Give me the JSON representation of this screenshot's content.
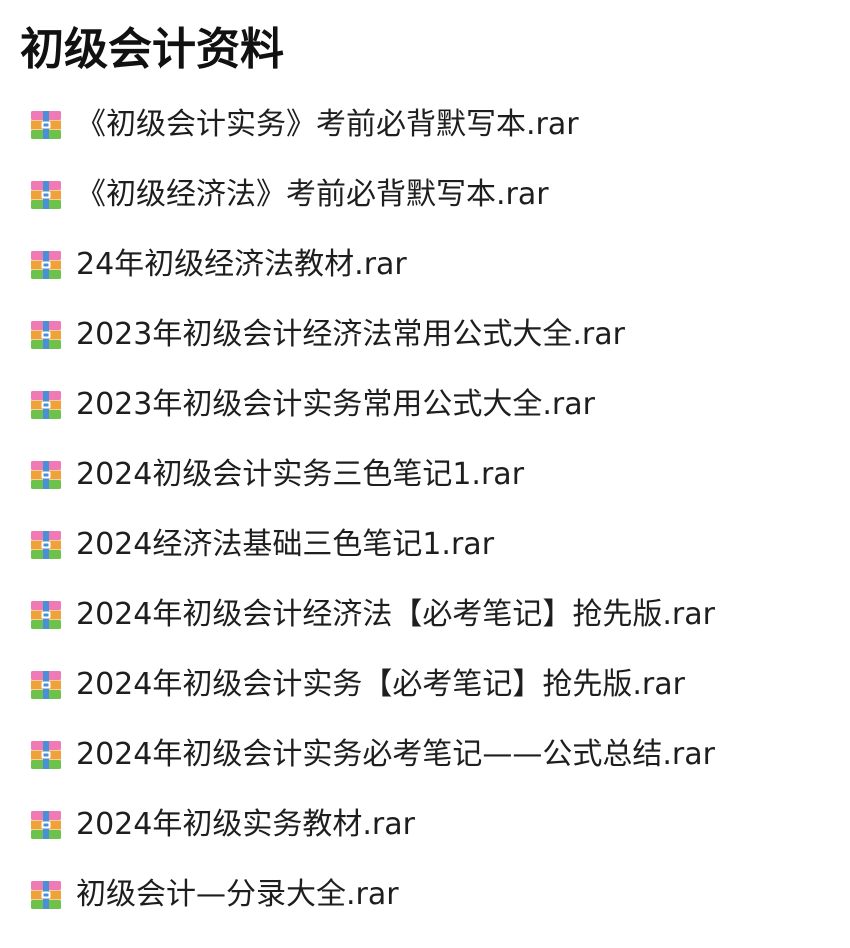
{
  "page": {
    "title": "初级会计资料"
  },
  "files": [
    {
      "name": "《初级会计实务》考前必背默写本.rar",
      "icon": "rar-archive-icon"
    },
    {
      "name": "《初级经济法》考前必背默写本.rar",
      "icon": "rar-archive-icon"
    },
    {
      "name": "24年初级经济法教材.rar",
      "icon": "rar-archive-icon"
    },
    {
      "name": "2023年初级会计经济法常用公式大全.rar",
      "icon": "rar-archive-icon"
    },
    {
      "name": "2023年初级会计实务常用公式大全.rar",
      "icon": "rar-archive-icon"
    },
    {
      "name": "2024初级会计实务三色笔记1.rar",
      "icon": "rar-archive-icon"
    },
    {
      "name": "2024经济法基础三色笔记1.rar",
      "icon": "rar-archive-icon"
    },
    {
      "name": "2024年初级会计经济法【必考笔记】抢先版.rar",
      "icon": "rar-archive-icon"
    },
    {
      "name": "2024年初级会计实务【必考笔记】抢先版.rar",
      "icon": "rar-archive-icon"
    },
    {
      "name": "2024年初级会计实务必考笔记——公式总结.rar",
      "icon": "rar-archive-icon"
    },
    {
      "name": "2024年初级实务教材.rar",
      "icon": "rar-archive-icon"
    },
    {
      "name": "初级会计—分录大全.rar",
      "icon": "rar-archive-icon"
    }
  ],
  "icon_colors": {
    "top": "#f07ab4",
    "middle": "#f0a23a",
    "bottom": "#6cc24a",
    "strap": "#4a90d9",
    "buckle": "#ffffff"
  }
}
